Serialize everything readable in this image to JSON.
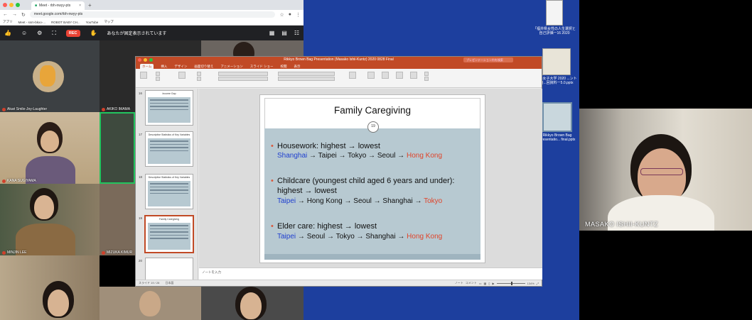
{
  "browser": {
    "tab_title": "Meet - rbh-nwyy-pts",
    "tab_close": "×",
    "new_tab": "+",
    "url": "meet.google.com/rbh-nwyy-pts",
    "bookmarks": [
      "アプリ",
      "Meet - ssm-bkxo-...",
      "ROBOT BABY CH...",
      "YouTube",
      "マップ"
    ]
  },
  "meet": {
    "rec_label": "REC",
    "notice": "あなたが固定表示されています"
  },
  "participants": [
    {
      "name": "Akari Smile-Joy-Laughter"
    },
    {
      "name": "AKIKO IMAMA"
    },
    {
      "name": "KANA SUGIYAMA"
    },
    {
      "name": "MINJIN LEE"
    },
    {
      "name": "MIZUKA KIMUR"
    },
    {
      "name": "MASAKO ISHII-KUNTZ"
    }
  ],
  "desktop": {
    "icons": [
      {
        "label": "「福井県女性の人生選択と自己評価ー16 2020"
      },
      {
        "label": "...心女子大学 2020 ...ント自...回資料ー5.0.pptx"
      },
      {
        "label": "Rikkyo Brown Bag Presentatio... final.pptx"
      }
    ]
  },
  "powerpoint": {
    "title": "Rikkyo Brown Bag Presentation (Masako Ishii-Kuntz) 2020 0828 Final",
    "search_placeholder": "プレゼンテーション内を検索",
    "menu": [
      "ホーム",
      "挿入",
      "デザイン",
      "画面切り替え",
      "アニメーション",
      "スライド ショー",
      "校閲",
      "表示"
    ],
    "notes_placeholder": "ノートを入力",
    "status_left": "スライド 19 / 28",
    "status_lang": "日本語",
    "status_notes": "ノート",
    "status_comments": "コメント",
    "zoom": "134%",
    "thumb_numbers": [
      "16",
      "17",
      "18",
      "19",
      "20"
    ],
    "thumb_titles": [
      "Income Gap",
      "Descriptive Statistics of Key Variables",
      "Descriptive Statistics of Key Variables",
      "Family Caregiving",
      ""
    ]
  },
  "slide": {
    "title": "Family Caregiving",
    "number": "19",
    "sections": [
      {
        "bullet": "Housework: highest → lowest",
        "route": [
          {
            "t": "Shanghai",
            "c": "blue"
          },
          {
            "t": " → Taipei → Tokyo → Seoul → ",
            "c": ""
          },
          {
            "t": "Hong Kong",
            "c": "red"
          }
        ]
      },
      {
        "bullet": "Childcare (youngest child aged 6 years and under): highest → lowest",
        "route": [
          {
            "t": "Taipei",
            "c": "blue"
          },
          {
            "t": " → Hong Kong → Seoul → Shanghai → ",
            "c": ""
          },
          {
            "t": "Tokyo",
            "c": "red"
          }
        ]
      },
      {
        "bullet": "Elder care: highest → lowest",
        "route": [
          {
            "t": "Taipei",
            "c": "blue"
          },
          {
            "t": " → Seoul → Tokyo → Shanghai → ",
            "c": ""
          },
          {
            "t": "Hong Kong",
            "c": "red"
          }
        ]
      }
    ]
  },
  "colors": {
    "ppt_accent": "#c14a26",
    "slide_body": "#b7c9d1",
    "highest": "#1f3fcf",
    "lowest": "#e0442a",
    "meet_rec": "#ea4335"
  }
}
